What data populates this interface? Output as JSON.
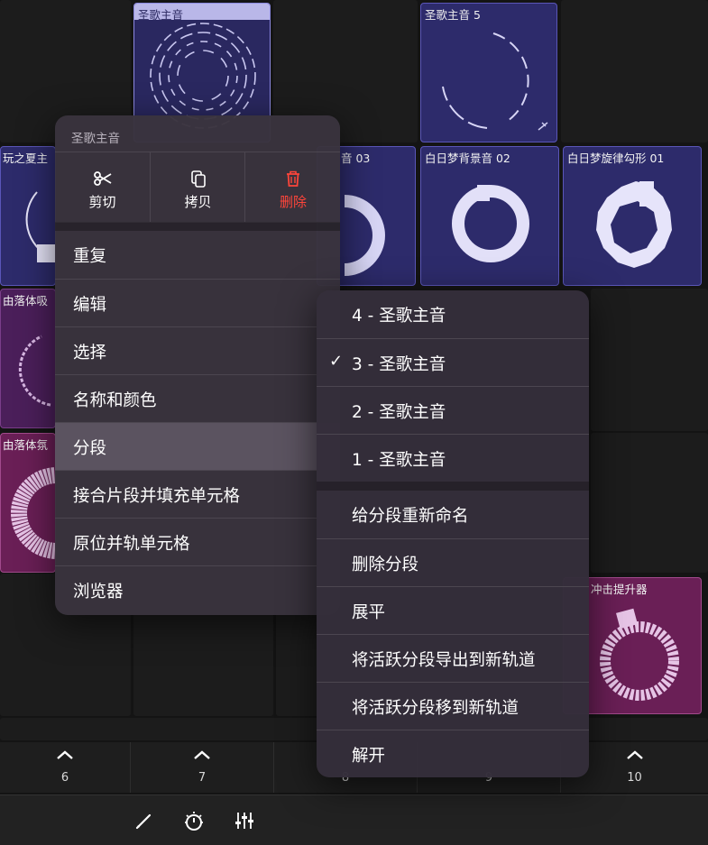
{
  "clips": {
    "top_selected": "圣歌主音",
    "top_right": "圣歌主音 5",
    "row2_a": "玩之夏主",
    "row2_b": "音 03",
    "row2_c": "白日梦背景音 02",
    "row2_d": "白日梦旋律勾形 01",
    "row3_a": "由落体吸",
    "row4_a": "由落体氛",
    "row5_pink": "冲击提升器"
  },
  "tracks": {
    "labels": [
      "6",
      "7",
      "8",
      "9",
      "10"
    ]
  },
  "context_menu": {
    "header": "圣歌主音",
    "actions": [
      {
        "label": "剪切",
        "icon": "scissors-icon"
      },
      {
        "label": "拷贝",
        "icon": "copy-icon"
      },
      {
        "label": "删除",
        "icon": "trash-icon",
        "color": "#ff453a"
      }
    ],
    "items": [
      "重复",
      "编辑",
      "选择",
      "名称和颜色",
      "分段",
      "接合片段并填充单元格",
      "原位并轨单元格",
      "浏览器"
    ],
    "active_item": "分段"
  },
  "submenu": {
    "sections": [
      "4 - 圣歌主音",
      "3 - 圣歌主音",
      "2 - 圣歌主音",
      "1 - 圣歌主音"
    ],
    "checked": "3 - 圣歌主音",
    "check_mark": "✓",
    "actions": [
      "给分段重新命名",
      "删除分段",
      "展平",
      "将活跃分段导出到新轨道",
      "将活跃分段移到新轨道",
      "解开"
    ]
  },
  "toolbar": {
    "icons": [
      "pencil-icon",
      "metronome-icon",
      "mixer-icon"
    ]
  },
  "colors": {
    "clip_blue": "#2d2b6b",
    "clip_purple": "#4b1f5a",
    "clip_pink": "#6a1f56",
    "destructive": "#ff453a"
  }
}
